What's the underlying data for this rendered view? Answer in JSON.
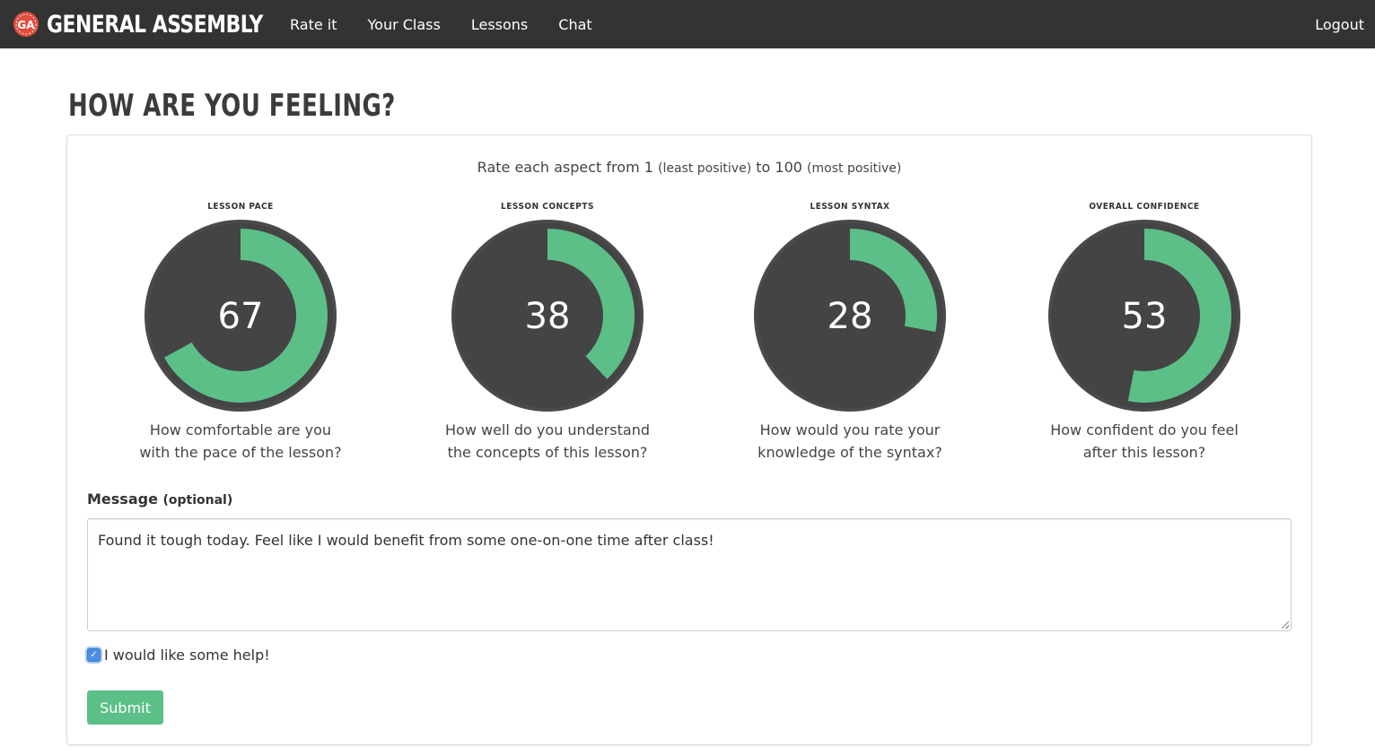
{
  "navbar": {
    "brand": "GENERAL ASSEMBLY",
    "logo_text": "GA",
    "links": [
      "Rate it",
      "Your Class",
      "Lessons",
      "Chat"
    ],
    "logout": "Logout"
  },
  "page_title": "HOW ARE YOU FEELING?",
  "instructions": {
    "prefix": "Rate each aspect from 1",
    "least": "(least positive)",
    "middle": "to 100",
    "most": "(most positive)"
  },
  "gauges": [
    {
      "label": "LESSON PACE",
      "value": 67,
      "question_line1": "How comfortable are you",
      "question_line2": "with the pace of the lesson?"
    },
    {
      "label": "LESSON CONCEPTS",
      "value": 38,
      "question_line1": "How well do you understand",
      "question_line2": "the concepts of this lesson?"
    },
    {
      "label": "LESSON SYNTAX",
      "value": 28,
      "question_line1": "How would you rate your",
      "question_line2": "knowledge of the syntax?"
    },
    {
      "label": "OVERALL CONFIDENCE",
      "value": 53,
      "question_line1": "How confident do you feel",
      "question_line2": "after this lesson?"
    }
  ],
  "gauge_scale": {
    "min": 1,
    "max": 100
  },
  "message": {
    "label": "Message",
    "optional": "(optional)",
    "value": "Found it tough today. Feel like I would benefit from some one-on-one time after class!"
  },
  "help_checkbox": {
    "label": "I would like some help!",
    "checked": true
  },
  "submit_label": "Submit",
  "colors": {
    "navbar": "#333333",
    "gauge_fill": "#5cbf88",
    "gauge_track": "#444444",
    "gauge_ring": "#4a4a4a",
    "accent": "#5cbf88",
    "logo_red": "#e24b3d"
  },
  "icons": {
    "checkbox": "check-icon",
    "logo": "ga-logo-icon"
  }
}
